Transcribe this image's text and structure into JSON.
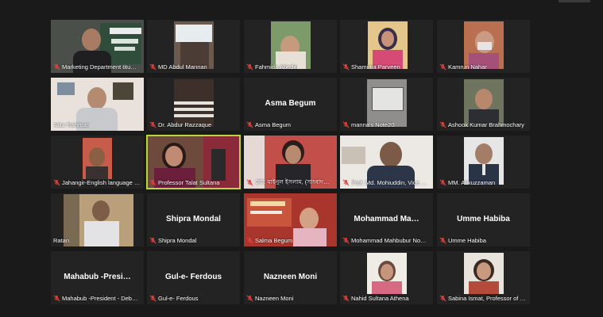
{
  "participants": [
    {
      "name": "Marketing Department titu…",
      "label": "",
      "video": true,
      "muted": true
    },
    {
      "name": "MD Abdul Mannan",
      "label": "",
      "video": true,
      "muted": true
    },
    {
      "name": "Fahmida Abedin",
      "label": "",
      "video": true,
      "muted": true
    },
    {
      "name": "Shamima Parveen",
      "label": "",
      "video": true,
      "muted": true
    },
    {
      "name": "Kamrun Nahar",
      "label": "",
      "video": true,
      "muted": true
    },
    {
      "name": "Atiur Rahman",
      "label": "",
      "video": true,
      "muted": false
    },
    {
      "name": "Dr. Abdur Razzaque",
      "label": "",
      "video": true,
      "muted": true
    },
    {
      "name": "Asma Begum",
      "label": "Asma Begum",
      "video": false,
      "muted": true
    },
    {
      "name": "manna's Note20",
      "label": "",
      "video": true,
      "muted": true
    },
    {
      "name": "Ashook Kumar Brahmochary",
      "label": "",
      "video": true,
      "muted": true
    },
    {
      "name": "Jahangir-English language …",
      "label": "",
      "video": true,
      "muted": true
    },
    {
      "name": "Professor Talat Sultana",
      "label": "",
      "video": true,
      "muted": true
    },
    {
      "name": "মোঃ মাইনুল ইসলাম, (সাংবাদ…",
      "label": "",
      "video": true,
      "muted": true
    },
    {
      "name": "Prof. Md. Mohiuddin, Vice Pri…",
      "label": "",
      "video": true,
      "muted": true
    },
    {
      "name": "MM. Atikuzzaman",
      "label": "",
      "video": true,
      "muted": true
    },
    {
      "name": "Ratan",
      "label": "",
      "video": true,
      "muted": false
    },
    {
      "name": "Shipra Mondal",
      "label": "Shipra Mondal",
      "video": false,
      "muted": true
    },
    {
      "name": "Salma Begum",
      "label": "",
      "video": true,
      "muted": true
    },
    {
      "name": "Mohammad Mahbubur No…",
      "label": "Mohammad  Ma…",
      "video": false,
      "muted": true
    },
    {
      "name": "Umme Habiba",
      "label": "Umme Habiba",
      "video": false,
      "muted": true
    },
    {
      "name": "Mahabub -President - Deb…",
      "label": "Mahabub  -Presi…",
      "video": false,
      "muted": true
    },
    {
      "name": "Gul-e- Ferdous",
      "label": "Gul-e- Ferdous",
      "video": false,
      "muted": true
    },
    {
      "name": "Nazneen Moni",
      "label": "Nazneen Moni",
      "video": false,
      "muted": true
    },
    {
      "name": "Nahid Sultana Athena",
      "label": "",
      "video": true,
      "muted": true
    },
    {
      "name": "Sabina Ismat, Professor of …",
      "label": "",
      "video": true,
      "muted": true
    }
  ],
  "colors": {
    "tile_bg": "#232323",
    "active_border": "#b6d83a",
    "muted_icon": "#e0413b"
  },
  "icons": {
    "muted": "mic-muted-icon",
    "unmuted": "mic-icon"
  }
}
